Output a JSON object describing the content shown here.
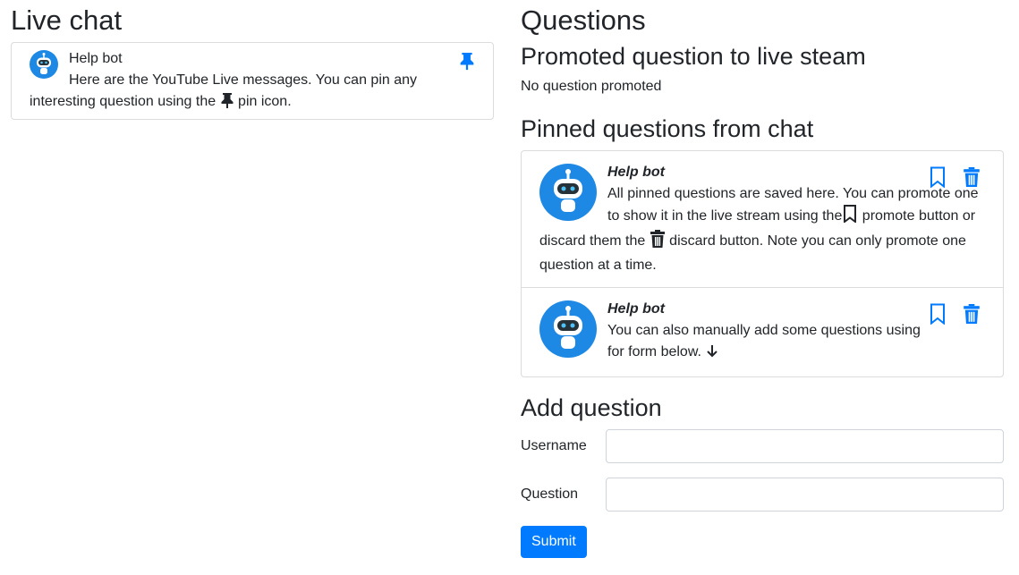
{
  "colors": {
    "accent": "#007bff",
    "text": "#212529",
    "border": "#dcdcdc"
  },
  "live_chat": {
    "title": "Live chat",
    "messages": [
      {
        "author": "Help bot",
        "text_before_icon": "Here are the YouTube Live messages. You can pin any interesting question using the ",
        "inline_icon": "pin-icon",
        "text_after_icon": " pin icon.",
        "action_icon": "pin-icon"
      }
    ]
  },
  "questions": {
    "title": "Questions",
    "promoted": {
      "title": "Promoted question to live steam",
      "empty_text": "No question promoted"
    },
    "pinned": {
      "title": "Pinned questions from chat",
      "items": [
        {
          "author": "Help bot",
          "text_part1": "All pinned questions are saved here. You can promote one to show it in the live stream using the",
          "icon1": "bookmark-icon",
          "text_part2": " promote button or discard them the ",
          "icon2": "trash-icon",
          "text_part3": " discard button. Note you can only promote one question at a time."
        },
        {
          "author": "Help bot",
          "text_part1": "You can also manually add some questions using for form below. ",
          "icon1": "arrow-down-icon"
        }
      ]
    },
    "add": {
      "title": "Add question",
      "username_label": "Username",
      "username_value": "",
      "question_label": "Question",
      "question_value": "",
      "submit_label": "Submit"
    }
  }
}
